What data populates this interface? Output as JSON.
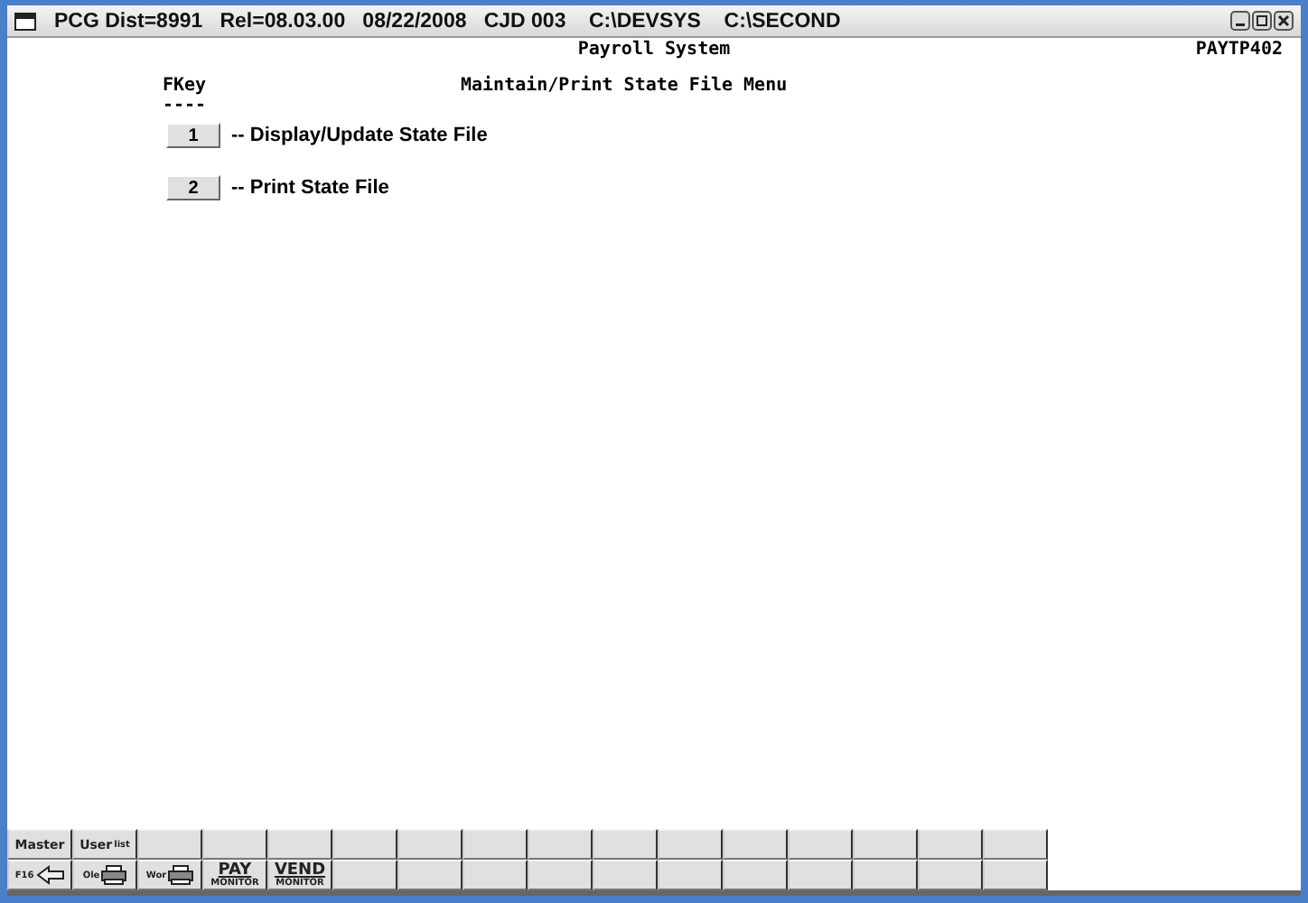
{
  "window": {
    "title": "PCG Dist=8991   Rel=08.03.00   08/22/2008   CJD 003    C:\\DEVSYS    C:\\SECOND"
  },
  "header": {
    "system": "Payroll System",
    "program": "PAYTP402"
  },
  "menu": {
    "fkey_label": "FKey",
    "fkey_rule": "----",
    "title": "Maintain/Print State File Menu",
    "items": [
      {
        "key": "1",
        "label": "-- Display/Update State File"
      },
      {
        "key": "2",
        "label": "-- Print State File"
      }
    ]
  },
  "toolbar": {
    "rows": [
      [
        {
          "kind": "text",
          "label": "Master"
        },
        {
          "kind": "sub",
          "label": "User",
          "sub": "list"
        }
      ],
      [
        {
          "kind": "arrow",
          "label": "F16"
        },
        {
          "kind": "printer",
          "label": "Ole"
        },
        {
          "kind": "printer",
          "label": "Wor"
        },
        {
          "kind": "monitor",
          "label": "PAY",
          "sub": "MONITOR"
        },
        {
          "kind": "monitor",
          "label": "VEND",
          "sub": "MONITOR"
        }
      ]
    ]
  }
}
